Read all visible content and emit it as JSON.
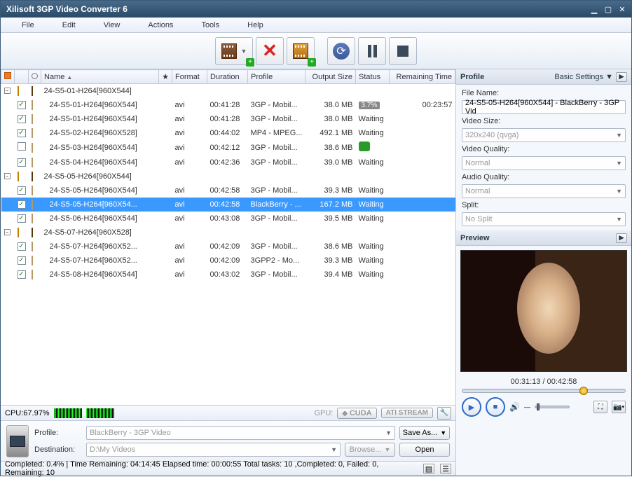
{
  "window": {
    "title": "Xilisoft 3GP Video Converter 6"
  },
  "menu": {
    "file": "File",
    "edit": "Edit",
    "view": "View",
    "actions": "Actions",
    "tools": "Tools",
    "help": "Help"
  },
  "columns": {
    "name": "Name",
    "format": "Format",
    "duration": "Duration",
    "profile": "Profile",
    "outputSize": "Output Size",
    "status": "Status",
    "remaining": "Remaining Time"
  },
  "rows": [
    {
      "type": "group",
      "chk": "",
      "name": "24-S5-01-H264[960X544]"
    },
    {
      "type": "child",
      "chk": "on",
      "name": "24-S5-01-H264[960X544]",
      "format": "avi",
      "duration": "00:41:28",
      "profile": "3GP - Mobil...",
      "size": "38.0 MB",
      "status": "3.7%",
      "statusType": "pct",
      "remaining": "00:23:57"
    },
    {
      "type": "child",
      "chk": "on",
      "name": "24-S5-01-H264[960X544]",
      "format": "avi",
      "duration": "00:41:28",
      "profile": "3GP - Mobil...",
      "size": "38.0 MB",
      "status": "Waiting"
    },
    {
      "type": "child",
      "chk": "on",
      "name": "24-S5-02-H264[960X528]",
      "format": "avi",
      "duration": "00:44:02",
      "profile": "MP4 - MPEG...",
      "size": "492.1 MB",
      "status": "Waiting"
    },
    {
      "type": "child",
      "chk": "",
      "name": "24-S5-03-H264[960X544]",
      "format": "avi",
      "duration": "00:42:12",
      "profile": "3GP - Mobil...",
      "size": "38.6 MB",
      "status": "done",
      "statusType": "green"
    },
    {
      "type": "child",
      "chk": "on",
      "name": "24-S5-04-H264[960X544]",
      "format": "avi",
      "duration": "00:42:36",
      "profile": "3GP - Mobil...",
      "size": "39.0 MB",
      "status": "Waiting"
    },
    {
      "type": "group",
      "chk": "",
      "name": "24-S5-05-H264[960X544]"
    },
    {
      "type": "child",
      "chk": "on",
      "name": "24-S5-05-H264[960X544]",
      "format": "avi",
      "duration": "00:42:58",
      "profile": "3GP - Mobil...",
      "size": "39.3 MB",
      "status": "Waiting"
    },
    {
      "type": "child",
      "chk": "on",
      "name": "24-S5-05-H264[960X54...",
      "format": "avi",
      "duration": "00:42:58",
      "profile": "BlackBerry - ...",
      "size": "167.2 MB",
      "status": "Waiting",
      "selected": true
    },
    {
      "type": "child",
      "chk": "on",
      "name": "24-S5-06-H264[960X544]",
      "format": "avi",
      "duration": "00:43:08",
      "profile": "3GP - Mobil...",
      "size": "39.5 MB",
      "status": "Waiting"
    },
    {
      "type": "group",
      "chk": "",
      "name": "24-S5-07-H264[960X528]"
    },
    {
      "type": "child",
      "chk": "on",
      "name": "24-S5-07-H264[960X52...",
      "format": "avi",
      "duration": "00:42:09",
      "profile": "3GP - Mobil...",
      "size": "38.6 MB",
      "status": "Waiting"
    },
    {
      "type": "child",
      "chk": "on",
      "name": "24-S5-07-H264[960X52...",
      "format": "avi",
      "duration": "00:42:09",
      "profile": "3GPP2 - Mo...",
      "size": "39.3 MB",
      "status": "Waiting"
    },
    {
      "type": "child",
      "chk": "on",
      "name": "24-S5-08-H264[960X544]",
      "format": "avi",
      "duration": "00:43:02",
      "profile": "3GP - Mobil...",
      "size": "39.4 MB",
      "status": "Waiting"
    }
  ],
  "sysbar": {
    "cpuLabel": "CPU:67.97%",
    "gpuLabel": "GPU:",
    "cuda": "CUDA",
    "ati": "ATI STREAM"
  },
  "bottom": {
    "profileLabel": "Profile:",
    "profileValue": "BlackBerry - 3GP Video",
    "saveAs": "Save As...",
    "destLabel": "Destination:",
    "destValue": "D:\\My Videos",
    "browse": "Browse...",
    "open": "Open"
  },
  "statusbar": {
    "text": "Completed: 0.4% | Time Remaining: 04:14:45 Elapsed time: 00:00:55 Total tasks: 10 ,Completed: 0, Failed: 0, Remaining: 10"
  },
  "profilePanel": {
    "title": "Profile",
    "settings": "Basic Settings ▼",
    "fileNameLabel": "File Name:",
    "fileName": "24-S5-05-H264[960X544] - BlackBerry - 3GP Vid",
    "videoSizeLabel": "Video Size:",
    "videoSize": "320x240 (qvga)",
    "videoQualityLabel": "Video Quality:",
    "videoQuality": "Normal",
    "audioQualityLabel": "Audio Quality:",
    "audioQuality": "Normal",
    "splitLabel": "Split:",
    "split": "No Split"
  },
  "preview": {
    "title": "Preview",
    "time": "00:31:13 / 00:42:58",
    "seekPct": 72
  }
}
